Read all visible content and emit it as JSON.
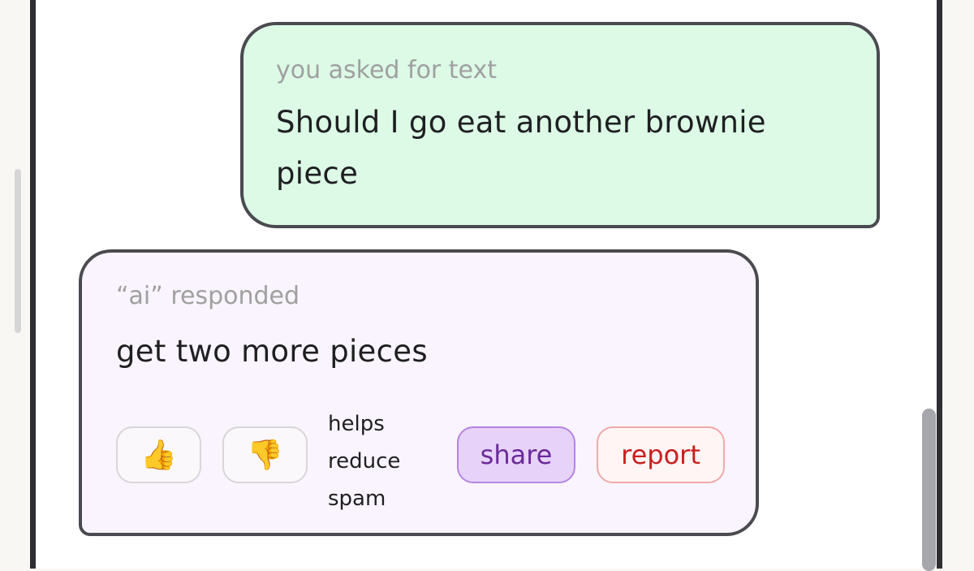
{
  "user_message": {
    "caption": "you asked for text",
    "text": "Should I go eat another brownie piece"
  },
  "ai_message": {
    "caption": "“ai” responded",
    "text": "get two more pieces"
  },
  "actions": {
    "thumbs_up": "👍",
    "thumbs_down": "👎",
    "hint_lines": [
      "helps",
      "reduce",
      "spam"
    ],
    "share_label": "share",
    "report_label": "report"
  },
  "colors": {
    "user_bubble_bg": "#dcfae6",
    "ai_bubble_bg": "#f9f4fd",
    "share_accent": "#6a2a99",
    "report_accent": "#c8201f"
  }
}
